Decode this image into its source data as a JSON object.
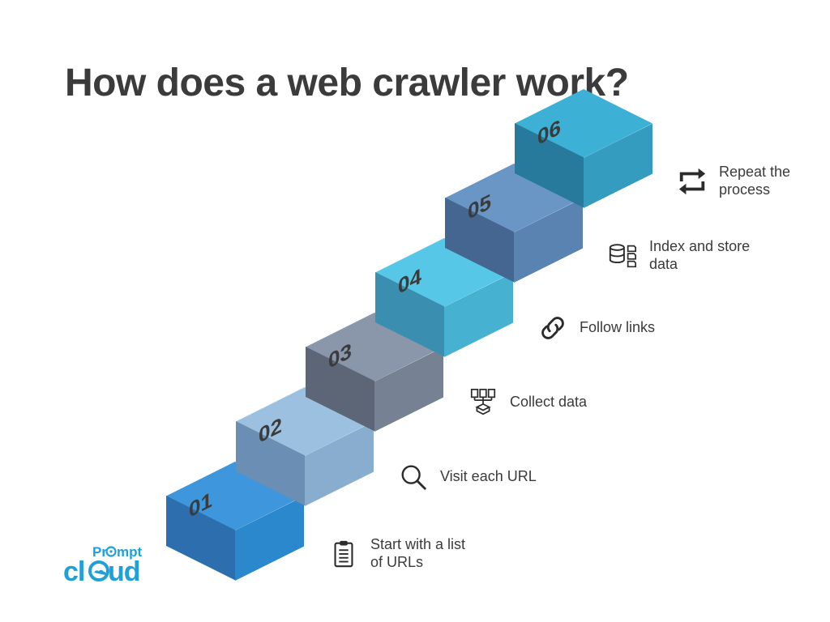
{
  "title": "How does a\nweb crawler\nwork?",
  "steps": [
    {
      "num": "01",
      "label": "Start with a list of URLs",
      "icon": "clipboard",
      "colors": {
        "top": "#3e97dd",
        "left": "#2d6fae",
        "right": "#2b88cc"
      }
    },
    {
      "num": "02",
      "label": "Visit each URL",
      "icon": "magnifier",
      "colors": {
        "top": "#9cc1e0",
        "left": "#6a8eb4",
        "right": "#88adce"
      }
    },
    {
      "num": "03",
      "label": "Collect data",
      "icon": "collect",
      "colors": {
        "top": "#8a96a9",
        "left": "#5d6677",
        "right": "#768294"
      }
    },
    {
      "num": "04",
      "label": "Follow links",
      "icon": "link",
      "colors": {
        "top": "#56c7e6",
        "left": "#3a8fb0",
        "right": "#47b1d1"
      }
    },
    {
      "num": "05",
      "label": "Index and store data",
      "icon": "database",
      "colors": {
        "top": "#6a96c6",
        "left": "#446691",
        "right": "#5a83b2"
      }
    },
    {
      "num": "06",
      "label": "Repeat the process",
      "icon": "repeat",
      "colors": {
        "top": "#3db0d6",
        "left": "#277a9b",
        "right": "#349dbf"
      }
    }
  ],
  "logo": {
    "top": "Prompt",
    "bottom": "cloud"
  }
}
